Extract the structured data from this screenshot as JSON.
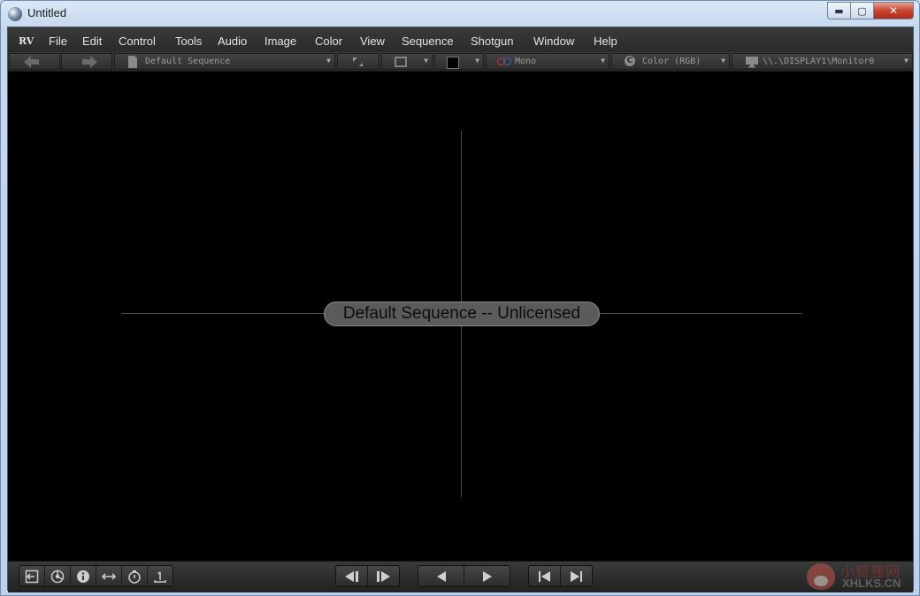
{
  "window": {
    "title": "Untitled",
    "controls": {
      "minimize": "▬",
      "maximize": "▢",
      "close": "✕"
    }
  },
  "menubar": {
    "logo": "RV",
    "items": [
      "File",
      "Edit",
      "Control",
      "Tools",
      "Audio",
      "Image",
      "Color",
      "View",
      "Sequence",
      "Shotgun",
      "Window",
      "Help"
    ]
  },
  "toolbar": {
    "source": "Default Sequence",
    "stereo": "Mono",
    "color_space": "Color (RGB)",
    "display": "\\\\.\\DISPLAY1\\Monitor0",
    "dropdown_glyph": "▼"
  },
  "viewer": {
    "overlay_text": "Default Sequence -- Unlicensed"
  },
  "watermark": {
    "line1": "小狐狸网",
    "line2": "XHLKS.CN"
  },
  "colors": {
    "background": "#000000",
    "bar": "#2e2e2e",
    "pill": "#5b5b5b",
    "menu_text": "#e4e4e4"
  }
}
